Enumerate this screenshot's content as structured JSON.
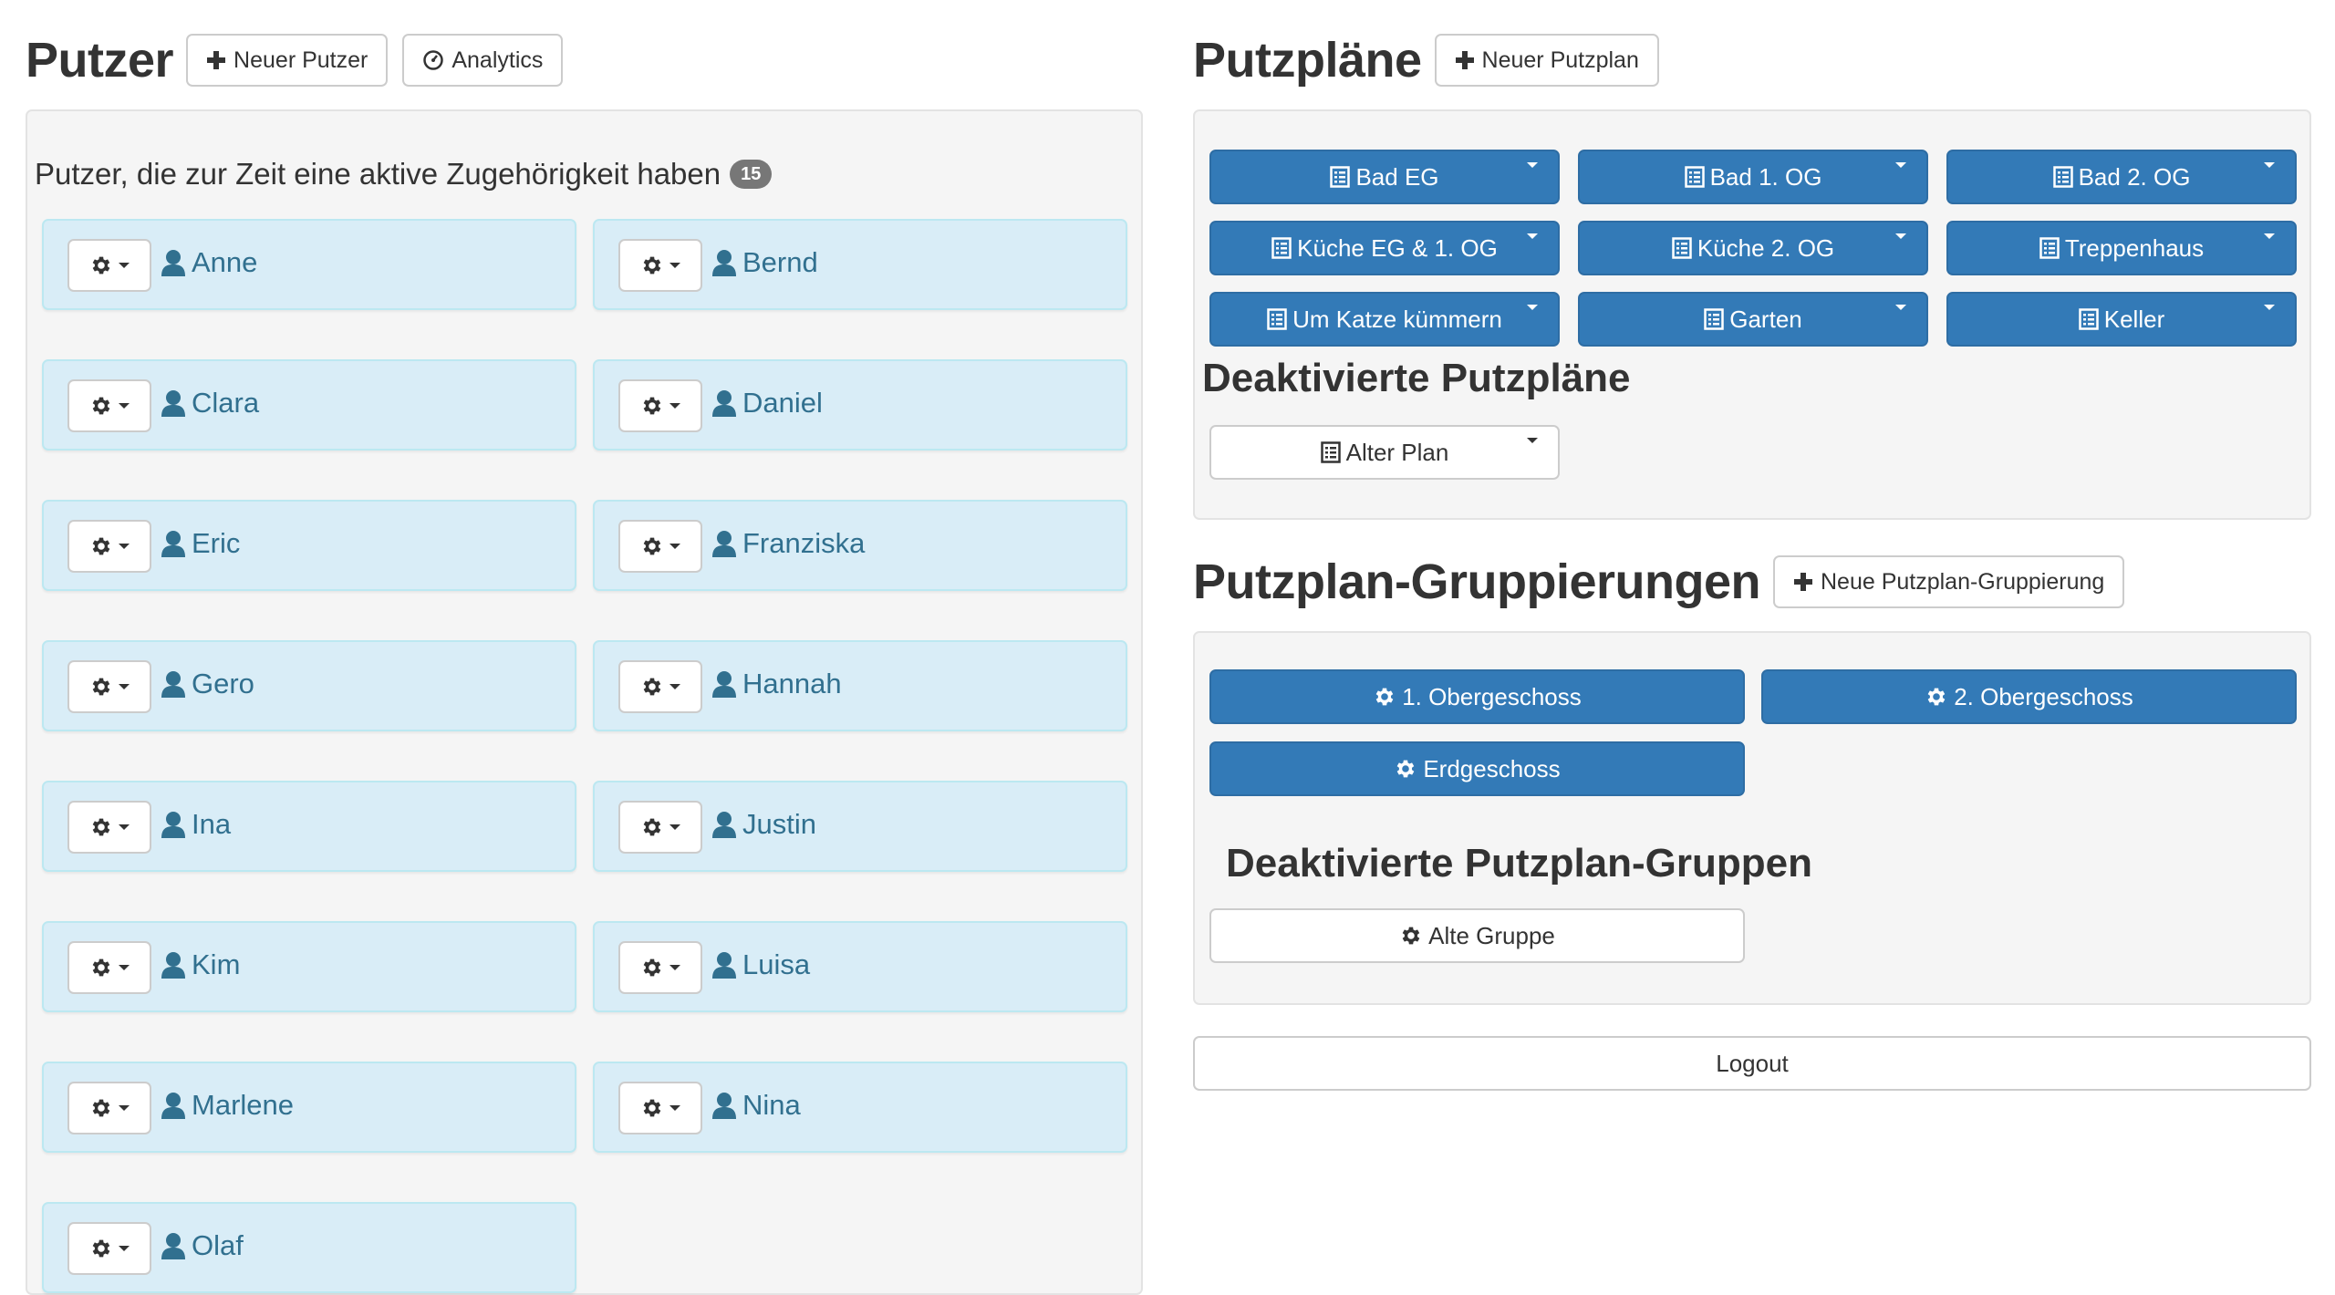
{
  "putzer": {
    "title": "Putzer",
    "new_button": "Neuer Putzer",
    "analytics_button": "Analytics",
    "active_heading": "Putzer, die zur Zeit eine aktive Zugehörigkeit haben",
    "active_count": "15",
    "people": [
      "Anne",
      "Bernd",
      "Clara",
      "Daniel",
      "Eric",
      "Franziska",
      "Gero",
      "Hannah",
      "Ina",
      "Justin",
      "Kim",
      "Luisa",
      "Marlene",
      "Nina",
      "Olaf"
    ]
  },
  "putzplaene": {
    "title": "Putzpläne",
    "new_button": "Neuer Putzplan",
    "active": [
      "Bad EG",
      "Bad 1. OG",
      "Bad 2. OG",
      "Küche EG & 1. OG",
      "Küche 2. OG",
      "Treppenhaus",
      "Um Katze kümmern",
      "Garten",
      "Keller"
    ],
    "deactivated_heading": "Deaktivierte Putzpläne",
    "deactivated": [
      "Alter Plan"
    ]
  },
  "gruppierungen": {
    "title": "Putzplan-Gruppierungen",
    "new_button": "Neue Putzplan-Gruppierung",
    "active": [
      "1. Obergeschoss",
      "2. Obergeschoss",
      "Erdgeschoss"
    ],
    "deactivated_heading": "Deaktivierte Putzplan-Gruppen",
    "deactivated": [
      "Alte Gruppe"
    ]
  },
  "logout_label": "Logout",
  "colors": {
    "primary": "#337ab7",
    "info_bg": "#d9edf7",
    "info_text": "#31708f",
    "well_bg": "#f5f5f5"
  }
}
